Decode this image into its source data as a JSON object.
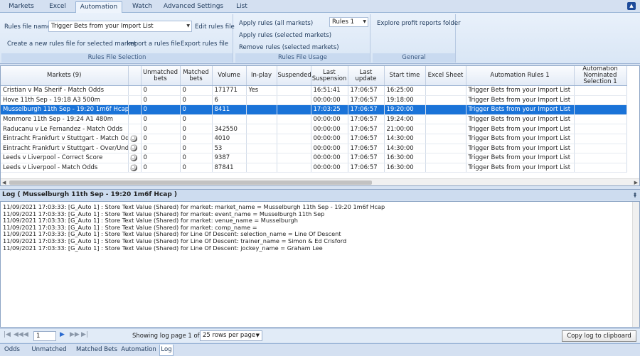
{
  "ribbon": {
    "tabs": [
      "Markets",
      "Excel",
      "Automation",
      "Watch",
      "Advanced Settings",
      "List"
    ],
    "active_tab": "Automation",
    "rules_file": {
      "label": "Rules file name",
      "value": "Trigger Bets from your Import List",
      "edit": "Edit rules file",
      "create": "Create a new rules file for selected market",
      "import": "Import a rules file",
      "export": "Export rules file",
      "group_title": "Rules File Selection"
    },
    "usage": {
      "apply_all": "Apply rules (all markets)",
      "apply_selected": "Apply rules (selected markets)",
      "remove_selected": "Remove rules (selected markets)",
      "rules_select": "Rules 1",
      "group_title": "Rules File Usage"
    },
    "general": {
      "explore": "Explore profit reports folder",
      "group_title": "General"
    }
  },
  "grid": {
    "columns": [
      "Markets (9)",
      "",
      "Unmatched bets",
      "Matched bets",
      "Volume",
      "In-play",
      "Suspended",
      "Last Suspension",
      "Last update",
      "Start time",
      "Excel Sheet",
      "Automation Rules 1",
      "Automation Nominated Selection 1"
    ],
    "rows": [
      {
        "market": "Cristian v Ma Sherif - Match Odds",
        "soccer": false,
        "unmatched": "0",
        "matched": "0",
        "volume": "171771",
        "inplay": "Yes",
        "suspended": "",
        "last_susp": "16:51:41",
        "last_update": "17:06:57",
        "start": "16:25:00",
        "excel": "",
        "rules": "Trigger Bets from your Import List",
        "nominated": ""
      },
      {
        "market": "Hove 11th Sep - 19:18 A3 500m",
        "soccer": false,
        "unmatched": "0",
        "matched": "0",
        "volume": "6",
        "inplay": "",
        "suspended": "",
        "last_susp": "00:00:00",
        "last_update": "17:06:57",
        "start": "19:18:00",
        "excel": "",
        "rules": "Trigger Bets from your Import List",
        "nominated": ""
      },
      {
        "market": "Musselburgh 11th Sep - 19:20 1m6f Hcap",
        "soccer": false,
        "unmatched": "0",
        "matched": "0",
        "volume": "8411",
        "inplay": "",
        "suspended": "",
        "last_susp": "17:03:25",
        "last_update": "17:06:57",
        "start": "19:20:00",
        "excel": "",
        "rules": "Trigger Bets from your Import List",
        "nominated": ""
      },
      {
        "market": "Monmore 11th Sep - 19:24 A1 480m",
        "soccer": false,
        "unmatched": "0",
        "matched": "0",
        "volume": "",
        "inplay": "",
        "suspended": "",
        "last_susp": "00:00:00",
        "last_update": "17:06:57",
        "start": "19:24:00",
        "excel": "",
        "rules": "Trigger Bets from your Import List",
        "nominated": ""
      },
      {
        "market": "Raducanu v Le Fernandez - Match Odds",
        "soccer": false,
        "unmatched": "0",
        "matched": "0",
        "volume": "342550",
        "inplay": "",
        "suspended": "",
        "last_susp": "00:00:00",
        "last_update": "17:06:57",
        "start": "21:00:00",
        "excel": "",
        "rules": "Trigger Bets from your Import List",
        "nominated": ""
      },
      {
        "market": "Eintracht Frankfurt v Stuttgart - Match Odds",
        "soccer": true,
        "unmatched": "0",
        "matched": "0",
        "volume": "4010",
        "inplay": "",
        "suspended": "",
        "last_susp": "00:00:00",
        "last_update": "17:06:57",
        "start": "14:30:00",
        "excel": "",
        "rules": "Trigger Bets from your Import List",
        "nominated": ""
      },
      {
        "market": "Eintracht Frankfurt v Stuttgart - Over/Under 2.5",
        "soccer": true,
        "unmatched": "0",
        "matched": "0",
        "volume": "53",
        "inplay": "",
        "suspended": "",
        "last_susp": "00:00:00",
        "last_update": "17:06:57",
        "start": "14:30:00",
        "excel": "",
        "rules": "Trigger Bets from your Import List",
        "nominated": ""
      },
      {
        "market": "Leeds v Liverpool - Correct Score",
        "soccer": true,
        "unmatched": "0",
        "matched": "0",
        "volume": "9387",
        "inplay": "",
        "suspended": "",
        "last_susp": "00:00:00",
        "last_update": "17:06:57",
        "start": "16:30:00",
        "excel": "",
        "rules": "Trigger Bets from your Import List",
        "nominated": ""
      },
      {
        "market": "Leeds v Liverpool - Match Odds",
        "soccer": true,
        "unmatched": "0",
        "matched": "0",
        "volume": "87841",
        "inplay": "",
        "suspended": "",
        "last_susp": "00:00:00",
        "last_update": "17:06:57",
        "start": "16:30:00",
        "excel": "",
        "rules": "Trigger Bets from your Import List",
        "nominated": ""
      }
    ],
    "selected_row": 2
  },
  "log": {
    "title": "Log ( Musselburgh 11th Sep - 19:20 1m6f Hcap )",
    "pin": "‡",
    "lines": [
      "11/09/2021 17:03:33: [G_Auto 1] : Store Text Value (Shared) for market: market_name = Musselburgh 11th Sep - 19:20 1m6f Hcap",
      "11/09/2021 17:03:33: [G_Auto 1] : Store Text Value (Shared) for market: event_name = Musselburgh 11th Sep",
      "11/09/2021 17:03:33: [G_Auto 1] : Store Text Value (Shared) for market: venue_name = Musselburgh",
      "11/09/2021 17:03:33: [G_Auto 1] : Store Text Value (Shared) for market: comp_name =",
      "11/09/2021 17:03:33: [G_Auto 1] : Store Text Value (Shared) for Line Of Descent: selection_name = Line Of Descent",
      "11/09/2021 17:03:33: [G_Auto 1] : Store Text Value (Shared) for Line Of Descent: trainer_name = Simon & Ed Crisford",
      "11/09/2021 17:03:33: [G_Auto 1] : Store Text Value (Shared) for Line Of Descent: jockey_name = Graham Lee"
    ]
  },
  "pager": {
    "page": "1",
    "info": "Showing log page 1 of 1 at",
    "rows_per_page": "25 rows per page",
    "copy": "Copy log to clipboard"
  },
  "bottom_tabs": [
    "Odds",
    "Unmatched Bets",
    "Matched Bets",
    "Automation",
    "Log"
  ],
  "active_bottom_tab": "Log"
}
